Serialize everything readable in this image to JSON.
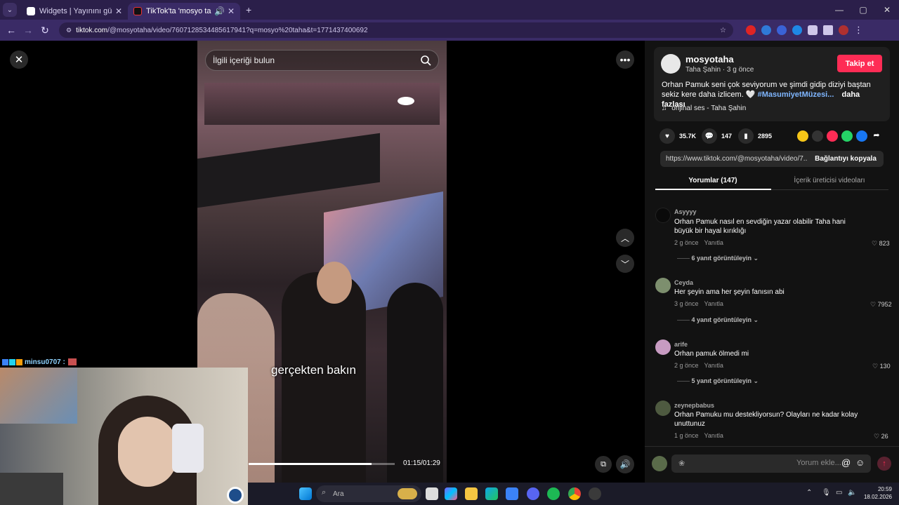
{
  "browser": {
    "tabs": [
      {
        "title": "Widgets | Yayınını güçlendirmek",
        "active": false
      },
      {
        "title": "TikTok'ta 'mosyo taha' bulab",
        "active": true
      }
    ],
    "new_tab": "+",
    "window_controls": [
      "—",
      "▢",
      "✕"
    ],
    "url_host": "tiktok.com",
    "url_path": "/@mosyotaha/video/7607128534485617941?q=mosyo%20taha&t=1771437400692"
  },
  "video": {
    "search_placeholder": "İlgili içeriği bulun",
    "caption": "gerçekten bakın",
    "time": "01:15/01:29",
    "progress_fraction": 0.84
  },
  "overlay": {
    "chat_user": "minsu0707 :"
  },
  "post": {
    "author": "mosyotaha",
    "subline": "Taha Şahin · 3 g önce",
    "follow_label": "Takip et",
    "description": "Orhan Pamuk seni çok seviyorum ve şimdi gidip diziyi baştan sekiz kere daha izlicem. 🤍",
    "hashtag": "#MasumiyetMüzesi...",
    "more_label": "daha fazlası",
    "music": "orijinal ses - Taha Şahin",
    "likes": "35.7K",
    "comments": "147",
    "saves": "2895",
    "link": "https://www.tiktok.com/@mosyotaha/video/7...",
    "copy_label": "Bağlantıyı kopyala"
  },
  "panel_tabs": [
    "Yorumlar (147)",
    "İçerik üreticisi videoları"
  ],
  "comments": [
    {
      "user": "Asyyyy",
      "text": "Orhan Pamuk nasıl en sevdiğin yazar olabilir Taha hani büyük bir hayal kırıklığı",
      "time": "2 g önce",
      "reply": "Yanıtla",
      "likes": "823",
      "replies": "6 yanıt görüntüleyin"
    },
    {
      "user": "Ceyda",
      "text": "Her şeyin ama her şeyin fanısın abi",
      "time": "3 g önce",
      "reply": "Yanıtla",
      "likes": "7952",
      "replies": "4 yanıt görüntüleyin"
    },
    {
      "user": "arife",
      "text": "Orhan pamuk ölmedi mi",
      "time": "2 g önce",
      "reply": "Yanıtla",
      "likes": "130",
      "replies": "5 yanıt görüntüleyin"
    },
    {
      "user": "zeynepbabus",
      "text": "Orhan Pamuku mu destekliyorsun? Olayları ne kadar kolay unuttunuz",
      "time": "1 g önce",
      "reply": "Yanıtla",
      "likes": "26",
      "replies": ""
    }
  ],
  "comment_input": {
    "placeholder": "Yorum ekle..."
  },
  "taskbar": {
    "search_label": "Ara",
    "time": "20:59",
    "date": "18.02.2026"
  },
  "colors": {
    "accent": "#fe2c55",
    "hashtag": "#7fb6ff",
    "chrome_frame": "#2b1f4a",
    "toolbar": "#3a2b66"
  }
}
